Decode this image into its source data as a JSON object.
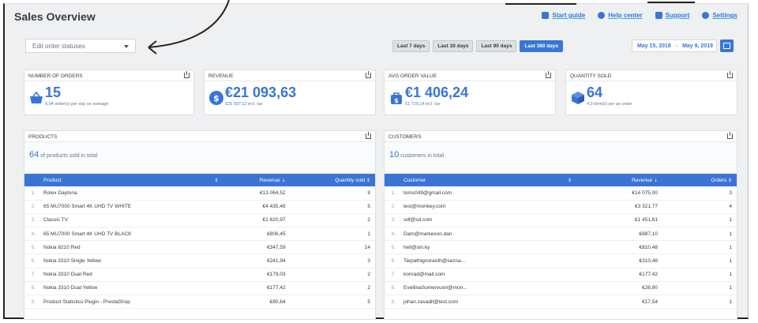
{
  "page": {
    "title": "Sales Overview"
  },
  "top_links": [
    {
      "label": "Start guide",
      "icon": "bookmark-icon"
    },
    {
      "label": "Help center",
      "icon": "question-icon"
    },
    {
      "label": "Support",
      "icon": "chat-icon"
    },
    {
      "label": "Settings",
      "icon": "gear-icon"
    }
  ],
  "status_select": {
    "value": "Edit order statuses"
  },
  "ranges": [
    {
      "label": "Last 7 days",
      "active": false
    },
    {
      "label": "Last 30 days",
      "active": false
    },
    {
      "label": "Last 90 days",
      "active": false
    },
    {
      "label": "Last 360 days",
      "active": true
    }
  ],
  "date_range": {
    "from": "May 15, 2018",
    "sep": "-",
    "to": "May 9, 2019"
  },
  "kpis": [
    {
      "label": "NUMBER OF ORDERS",
      "value": "15",
      "sub_value": "0,04",
      "sub_text": "order(s) per day on average",
      "icon": "basket-icon"
    },
    {
      "label": "REVENUE",
      "value": "€21 093,63",
      "sub_value": "€25 937,12",
      "sub_text": "incl. tax",
      "icon": "dollar-icon"
    },
    {
      "label": "AVG ORDER VALUE",
      "value": "€1 406,24",
      "sub_value": "€1 729,14",
      "sub_text": "incl. tax",
      "icon": "bag-icon"
    },
    {
      "label": "QUANTITY SOLD",
      "value": "64",
      "sub_value": "4,3",
      "sub_text": "item(s) per an order",
      "icon": "box-icon"
    }
  ],
  "products": {
    "title": "PRODUCTS",
    "count": "64",
    "count_text": "of products sold in total",
    "headers": [
      "Product",
      "Revenue",
      "Quantity sold"
    ],
    "rows": [
      [
        "1.",
        "Rolex Daytona",
        "€13 064,52",
        "9"
      ],
      [
        "2.",
        "65 MU7000 Smart 4K UHD TV WHITE",
        "€4 435,49",
        "5"
      ],
      [
        "3.",
        "Classic TV",
        "€1 620,97",
        "2"
      ],
      [
        "4.",
        "65 MU7000 Smart 4K UHD TV BLACK",
        "€806,45",
        "1"
      ],
      [
        "5.",
        "Nokia 8210 Red",
        "€347,59",
        "14"
      ],
      [
        "6.",
        "Nokia 3310 Single Yellow",
        "€241,94",
        "3"
      ],
      [
        "7.",
        "Nokia 3310 Dual Red",
        "€179,03",
        "2"
      ],
      [
        "8.",
        "Nokia 3310 Dual Yellow",
        "€177,42",
        "2"
      ],
      [
        "9.",
        "Product Statistics Plugin - PrestaShop",
        "€80,64",
        "5"
      ]
    ]
  },
  "customers": {
    "title": "CUSTOMERS",
    "count": "10",
    "count_text": "customers in total",
    "headers": [
      "Customer",
      "Revenue",
      "Orders"
    ],
    "rows": [
      [
        "1.",
        "toms049@gmail.com",
        "€14 075,00",
        "3"
      ],
      [
        "2.",
        "test@monkey.com",
        "€3 321,77",
        "4"
      ],
      [
        "3.",
        "sdf@sd.com",
        "€1 451,61",
        "1"
      ],
      [
        "4.",
        "Dam@markexon.dan",
        "€887,10",
        "1"
      ],
      [
        "5.",
        "hell@sin.ky",
        "€810,48",
        "1"
      ],
      [
        "6.",
        "Tarpathignoranth@sezna...",
        "€310,48",
        "1"
      ],
      [
        "7.",
        "konrad@mail.com",
        "€177,42",
        "1"
      ],
      [
        "8.",
        "EvellinaSomervuori@mon...",
        "€26,90",
        "1"
      ],
      [
        "9.",
        "johan.zavadil@test.com",
        "€17,54",
        "1"
      ]
    ]
  },
  "colors": {
    "accent": "#3a75d6",
    "link": "#3a75d6"
  }
}
